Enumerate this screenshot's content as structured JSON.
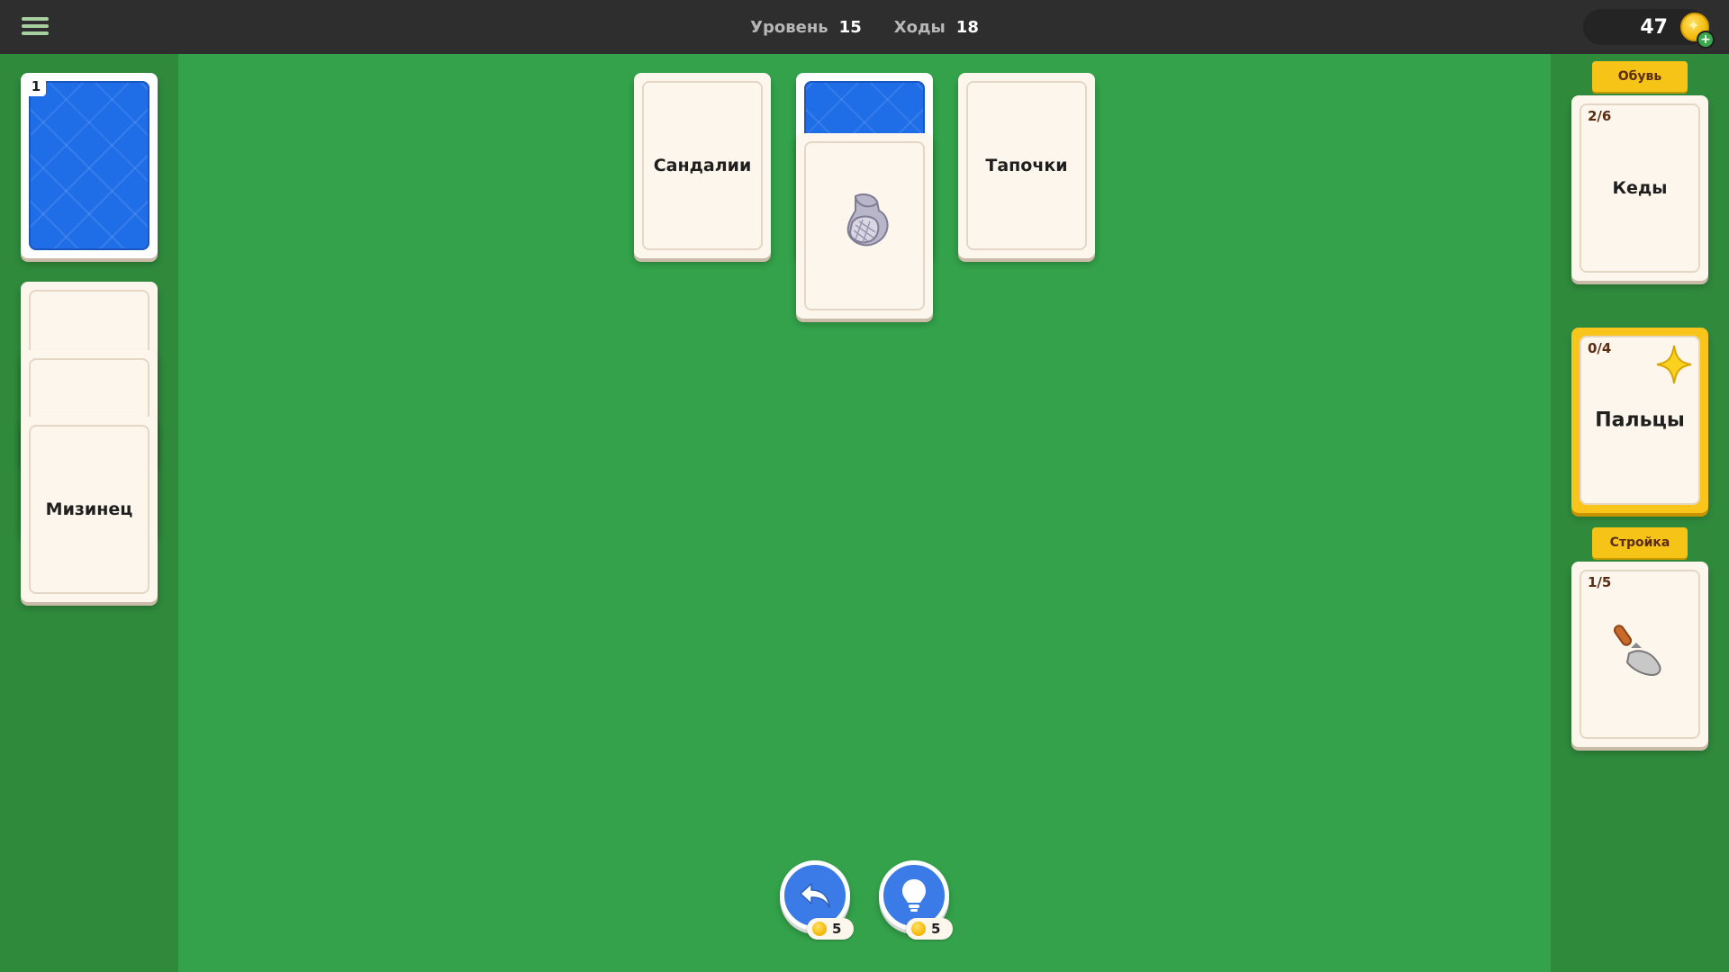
{
  "header": {
    "level_label": "Уровень",
    "level_value": "15",
    "moves_label": "Ходы",
    "moves_value": "18",
    "coins": "47",
    "menu_icon": "hamburger-menu-icon",
    "coin_icon": "coin-star-icon",
    "add_coins_icon": "plus-icon"
  },
  "deck": {
    "remaining": "1",
    "back_color": "#1f6ee8"
  },
  "left_stack": {
    "top_card_label": "Мизинец"
  },
  "board": {
    "card1_label": "Сандалии",
    "card3_label": "Тапочки",
    "card2_icon": "shoe-icon"
  },
  "goals": [
    {
      "tag": "Обувь",
      "count": "2/6",
      "label": "Кеды"
    },
    {
      "tag": "",
      "count": "0/4",
      "label": "Пальцы",
      "icon": "sparkle-star-icon",
      "highlight": "#f9c51a"
    },
    {
      "tag": "Стройка",
      "count": "1/5",
      "label": "",
      "icon": "trowel-icon"
    }
  ],
  "actions": {
    "undo_price": "5",
    "hint_price": "5",
    "undo_icon": "undo-arrow-icon",
    "hint_icon": "lightbulb-icon"
  }
}
